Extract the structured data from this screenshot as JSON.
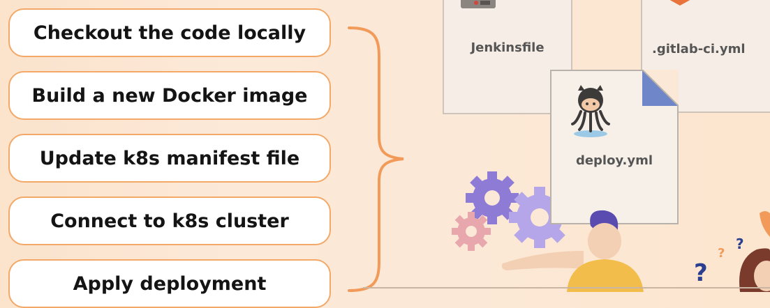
{
  "steps": [
    {
      "label": "Checkout the code locally"
    },
    {
      "label": "Build a new Docker image"
    },
    {
      "label": "Update k8s manifest file"
    },
    {
      "label": "Connect to k8s cluster"
    },
    {
      "label": "Apply deployment"
    }
  ],
  "files": {
    "jenkins": "Jenkinsfile",
    "gitlab": ".gitlab-ci.yml",
    "deploy": "deploy.yml"
  },
  "icons": {
    "jenkins": "jenkins-icon",
    "gitlab": "gitlab-icon",
    "deploy": "github-octocat-icon"
  },
  "question_marks": [
    "?",
    "?",
    "?"
  ],
  "colors": {
    "step_border": "#f3a868",
    "brace": "#f29a5a",
    "gear_purple": "#8e7bd6",
    "gear_pink": "#e8a6ad",
    "gear_lavender": "#b4a6e8"
  }
}
